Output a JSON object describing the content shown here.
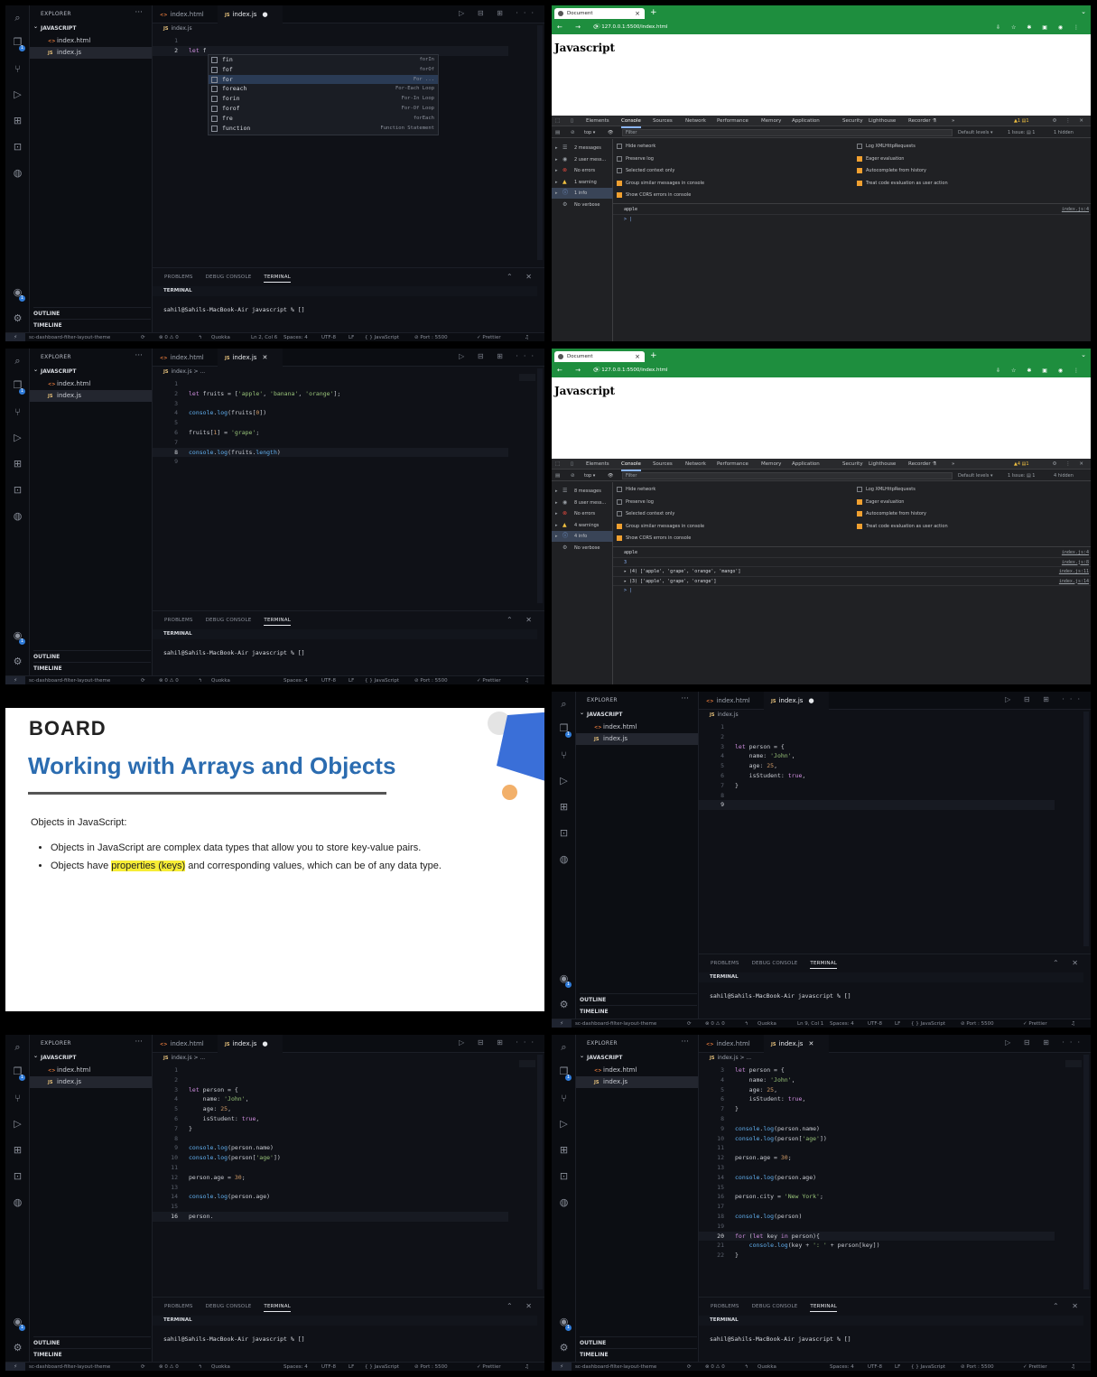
{
  "vscode": {
    "explorer_title": "EXPLORER",
    "project": "JAVASCRIPT",
    "files": [
      {
        "name": "index.html",
        "icon": "html-file-icon"
      },
      {
        "name": "index.js",
        "icon": "js-file-icon"
      }
    ],
    "outline": "OUTLINE",
    "timeline": "TIMELINE",
    "tab_html": "index.html",
    "tab_js": "index.js",
    "breadcrumb": "index.js",
    "breadcrumb_more": "index.js > ...",
    "panel_tabs": [
      "PROBLEMS",
      "DEBUG CONSOLE",
      "TERMINAL"
    ],
    "terminal_header": "TERMINAL",
    "prompt": "sahil@Sahils-MacBook-Air javascript % []",
    "status": {
      "branch": "sc-dashboard-filter-layout-theme",
      "errors": "⊗ 0 ⚠ 0",
      "quokka": "Quokka",
      "pos_a": "Ln 2, Col 6",
      "pos_b": "Ln 9, Col 1",
      "spaces": "Spaces: 4",
      "enc": "UTF-8",
      "eol": "LF",
      "lang": "{ } JavaScript",
      "port": "⊘ Port : 5500",
      "prettier": "✓ Prettier"
    }
  },
  "suggest": [
    {
      "label": "fin",
      "detail": "forIn"
    },
    {
      "label": "fof",
      "detail": "forOf"
    },
    {
      "label": "for",
      "detail": "For ..."
    },
    {
      "label": "foreach",
      "detail": "For-Each Loop"
    },
    {
      "label": "forin",
      "detail": "For-In Loop"
    },
    {
      "label": "forof",
      "detail": "For-Of Loop"
    },
    {
      "label": "fre",
      "detail": "forEach"
    },
    {
      "label": "function",
      "detail": "Function Statement"
    }
  ],
  "browser": {
    "tab_title": "Document",
    "url": "127.0.0.1:5500/index.html",
    "heading": "Javascript",
    "devtools_tabs": [
      "Elements",
      "Console",
      "Sources",
      "Network",
      "Performance",
      "Memory",
      "Application",
      "Security",
      "Lighthouse",
      "Recorder ⚗"
    ],
    "more": "»",
    "context": "top ▾",
    "filter_placeholder": "Filter",
    "levels": "Default levels ▾",
    "issue": "1 Issue: ▤ 1",
    "hidden_a": "1 hidden",
    "hidden_b": "4 hidden",
    "warn_a": "▲1 ▤1",
    "warn_b": "▲4 ▤1",
    "options_left": [
      "Hide network",
      "Preserve log",
      "Selected context only",
      "Group similar messages in console",
      "Show CORS errors in console"
    ],
    "options_right": [
      "Log XMLHttpRequests",
      "Eager evaluation",
      "Autocomplete from history",
      "Treat code evaluation as user action"
    ],
    "sidebar_a": [
      "2 messages",
      "2 user mess...",
      "No errors",
      "1 warning",
      "1 info",
      "No verbose"
    ],
    "sidebar_b": [
      "8 messages",
      "8 user mess...",
      "No errors",
      "4 warnings",
      "4 info",
      "No verbose"
    ],
    "console_a": [
      {
        "text": "apple",
        "src": "index.js:4"
      }
    ],
    "console_b": [
      {
        "text": "apple",
        "src": "index.js:4"
      },
      {
        "text": "3",
        "src": "index.js:8"
      },
      {
        "text": "▸ (4) ['apple', 'grape', 'orange', 'mango']",
        "src": "index.js:11"
      },
      {
        "text": "▸ (3) ['apple', 'grape', 'orange']",
        "src": "index.js:14"
      }
    ],
    "input_caret": "> |"
  },
  "slide": {
    "logo": "BOARD",
    "title": "Working with Arrays and Objects",
    "subtitle": "Objects in JavaScript:",
    "bullet1": "Objects in JavaScript are complex data types that allow you to store key-value pairs.",
    "bullet2_pre": "Objects have ",
    "bullet2_hl": "properties (keys)",
    "bullet2_post": " and corresponding values, which can be of any data type."
  },
  "code1": [
    {
      "n": "1",
      "t": ""
    },
    {
      "n": "2",
      "t": "let f",
      "cur": true
    }
  ],
  "code3": [
    {
      "n": "1",
      "t": ""
    },
    {
      "n": "2",
      "t": "let fruits = ['apple', 'banana', 'orange'];"
    },
    {
      "n": "3",
      "t": ""
    },
    {
      "n": "4",
      "t": "console.log(fruits[0])"
    },
    {
      "n": "5",
      "t": ""
    },
    {
      "n": "6",
      "t": "fruits[1] = 'grape';"
    },
    {
      "n": "7",
      "t": ""
    },
    {
      "n": "8",
      "t": "console.log(fruits.length)",
      "cur": true
    },
    {
      "n": "9",
      "t": ""
    }
  ],
  "code6": [
    {
      "n": "1",
      "t": ""
    },
    {
      "n": "2",
      "t": ""
    },
    {
      "n": "3",
      "t": "let person = {"
    },
    {
      "n": "4",
      "t": "    name: 'John',"
    },
    {
      "n": "5",
      "t": "    age: 25,"
    },
    {
      "n": "6",
      "t": "    isStudent: true,"
    },
    {
      "n": "7",
      "t": "}"
    },
    {
      "n": "8",
      "t": ""
    },
    {
      "n": "9",
      "t": "",
      "cur": true
    }
  ],
  "code7": [
    {
      "n": "1",
      "t": ""
    },
    {
      "n": "2",
      "t": ""
    },
    {
      "n": "3",
      "t": "let person = {"
    },
    {
      "n": "4",
      "t": "    name: 'John',"
    },
    {
      "n": "5",
      "t": "    age: 25,"
    },
    {
      "n": "6",
      "t": "    isStudent: true,"
    },
    {
      "n": "7",
      "t": "}"
    },
    {
      "n": "8",
      "t": ""
    },
    {
      "n": "9",
      "t": "console.log(person.name)"
    },
    {
      "n": "10",
      "t": "console.log(person['age'])"
    },
    {
      "n": "11",
      "t": ""
    },
    {
      "n": "12",
      "t": "person.age = 30;"
    },
    {
      "n": "13",
      "t": ""
    },
    {
      "n": "14",
      "t": "console.log(person.age)"
    },
    {
      "n": "15",
      "t": ""
    },
    {
      "n": "16",
      "t": "person.",
      "cur": true
    }
  ],
  "code8": [
    {
      "n": "3",
      "t": "let person = {"
    },
    {
      "n": "4",
      "t": "    name: 'John',"
    },
    {
      "n": "5",
      "t": "    age: 25,"
    },
    {
      "n": "6",
      "t": "    isStudent: true,"
    },
    {
      "n": "7",
      "t": "}"
    },
    {
      "n": "8",
      "t": ""
    },
    {
      "n": "9",
      "t": "console.log(person.name)"
    },
    {
      "n": "10",
      "t": "console.log(person['age'])"
    },
    {
      "n": "11",
      "t": ""
    },
    {
      "n": "12",
      "t": "person.age = 30;"
    },
    {
      "n": "13",
      "t": ""
    },
    {
      "n": "14",
      "t": "console.log(person.age)"
    },
    {
      "n": "15",
      "t": ""
    },
    {
      "n": "16",
      "t": "person.city = 'New York';"
    },
    {
      "n": "17",
      "t": ""
    },
    {
      "n": "18",
      "t": "console.log(person)"
    },
    {
      "n": "19",
      "t": ""
    },
    {
      "n": "20",
      "t": "for (let key in person){",
      "cur": true
    },
    {
      "n": "21",
      "t": "    console.log(key + ': ' + person[key])"
    },
    {
      "n": "22",
      "t": "}"
    }
  ]
}
